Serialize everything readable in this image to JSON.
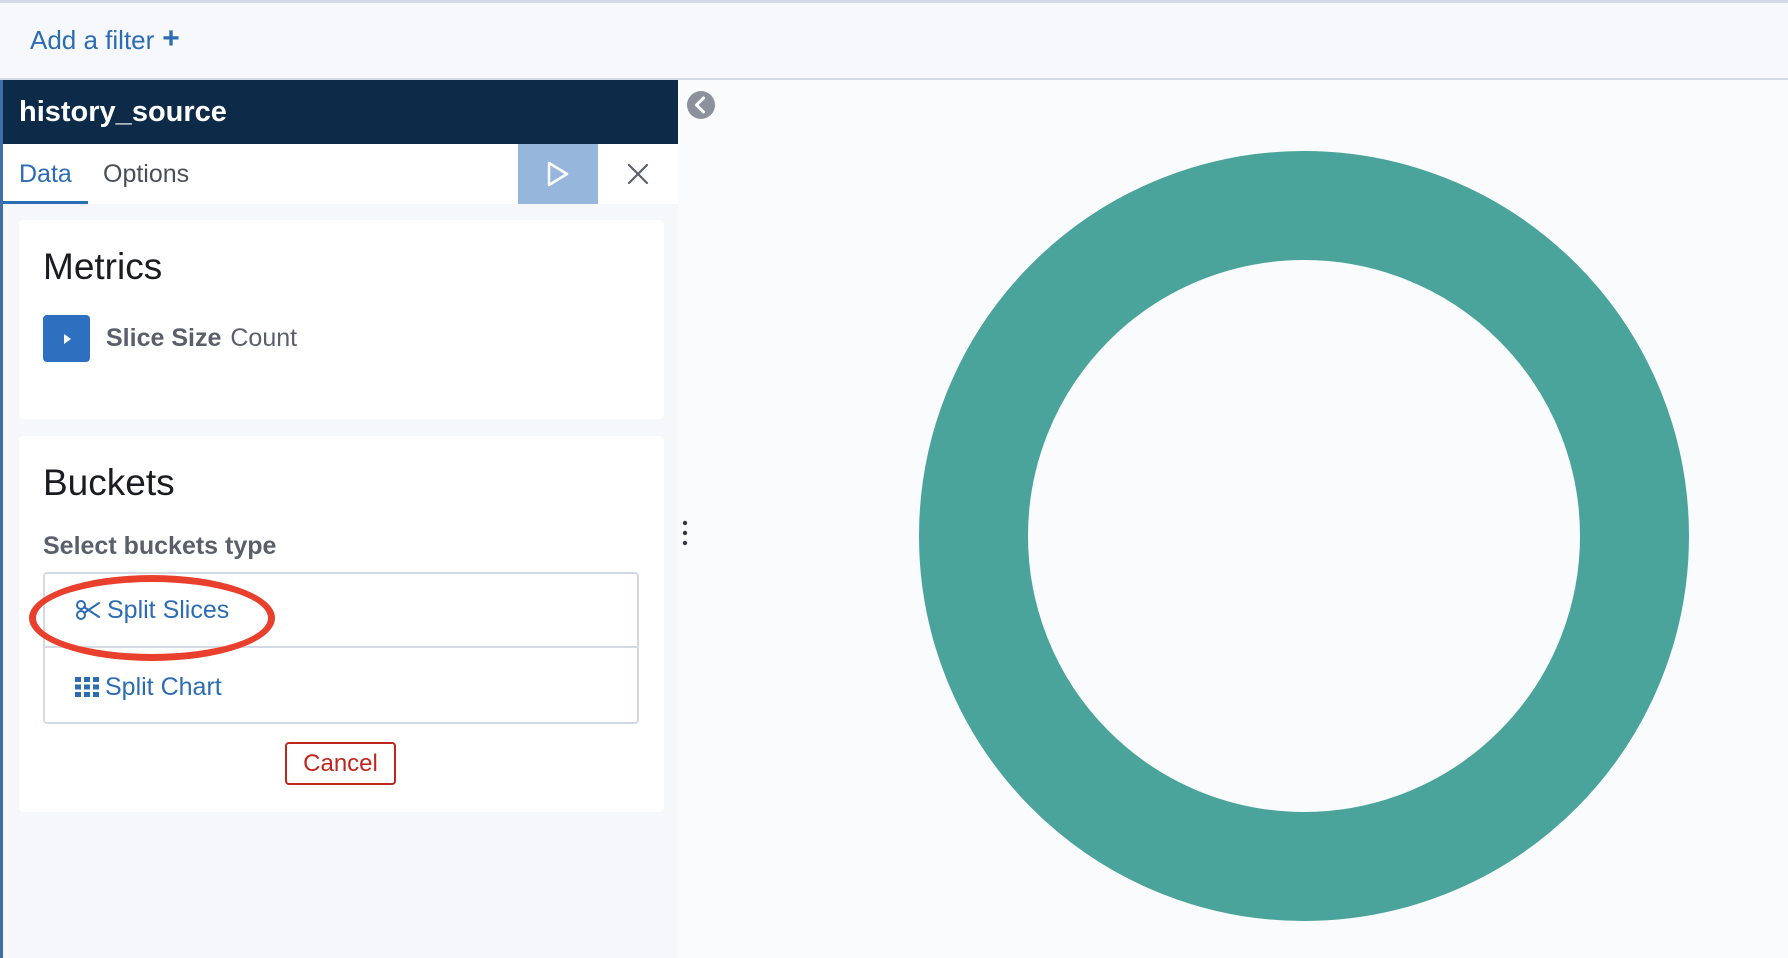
{
  "filter_bar": {
    "add_filter_label": "Add a filter"
  },
  "sidebar": {
    "index_name": "history_source",
    "tabs": [
      {
        "label": "Data",
        "active": true
      },
      {
        "label": "Options",
        "active": false
      }
    ],
    "metrics": {
      "title": "Metrics",
      "items": [
        {
          "label": "Slice Size",
          "value": "Count"
        }
      ]
    },
    "buckets": {
      "title": "Buckets",
      "select_label": "Select buckets type",
      "options": [
        {
          "label": "Split Slices",
          "icon": "scissors-icon",
          "highlighted": true
        },
        {
          "label": "Split Chart",
          "icon": "grid-icon",
          "highlighted": false
        }
      ],
      "cancel_label": "Cancel"
    }
  },
  "visualization": {
    "type": "donut",
    "slices": [
      {
        "value": 100,
        "color": "#4aa49b"
      }
    ]
  },
  "colors": {
    "header_bg": "#0d2a48",
    "accent": "#2b6cb3",
    "apply_bg": "#97b6dc",
    "danger": "#bd271e",
    "highlight": "#e8402c",
    "donut": "#4aa49b"
  }
}
